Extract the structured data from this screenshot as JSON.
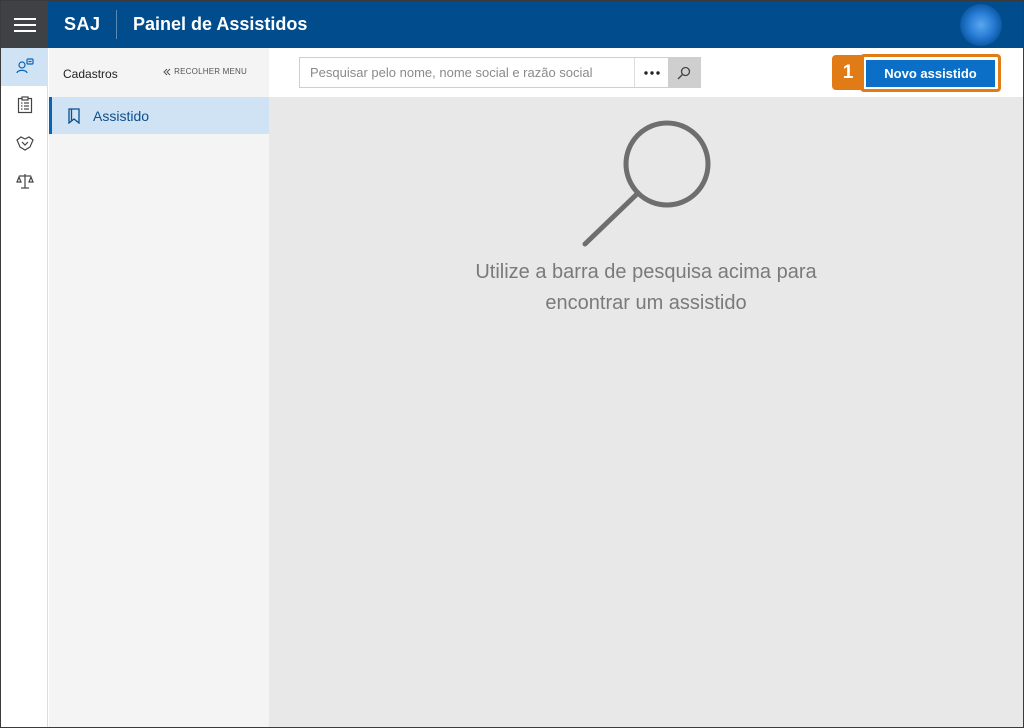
{
  "header": {
    "brand": "SAJ",
    "title": "Painel de Assistidos",
    "hamburger_icon": "hamburger-icon",
    "avatar_icon": "avatar",
    "color": "#004c8c"
  },
  "rail": {
    "items": [
      {
        "icon": "user-search-icon",
        "active": true
      },
      {
        "icon": "clipboard-list-icon",
        "active": false
      },
      {
        "icon": "handshake-icon",
        "active": false
      },
      {
        "icon": "scales-icon",
        "active": false
      }
    ]
  },
  "menu": {
    "title": "Cadastros",
    "collapse_label": "RECOLHER MENU",
    "items": [
      {
        "label": "Assistido",
        "icon": "bookmark-icon",
        "active": true
      }
    ]
  },
  "toolbar": {
    "search_placeholder": "Pesquisar pelo nome, nome social e razão social",
    "search_value": "",
    "more_label": "•••",
    "new_button_label": "Novo assistido",
    "callout_number": "1",
    "accent_color": "#0b6fc7",
    "callout_color": "#e07b16"
  },
  "empty_state": {
    "line1": "Utilize a barra de pesquisa acima para",
    "line2": "encontrar um assistido",
    "icon": "magnifier-icon"
  }
}
